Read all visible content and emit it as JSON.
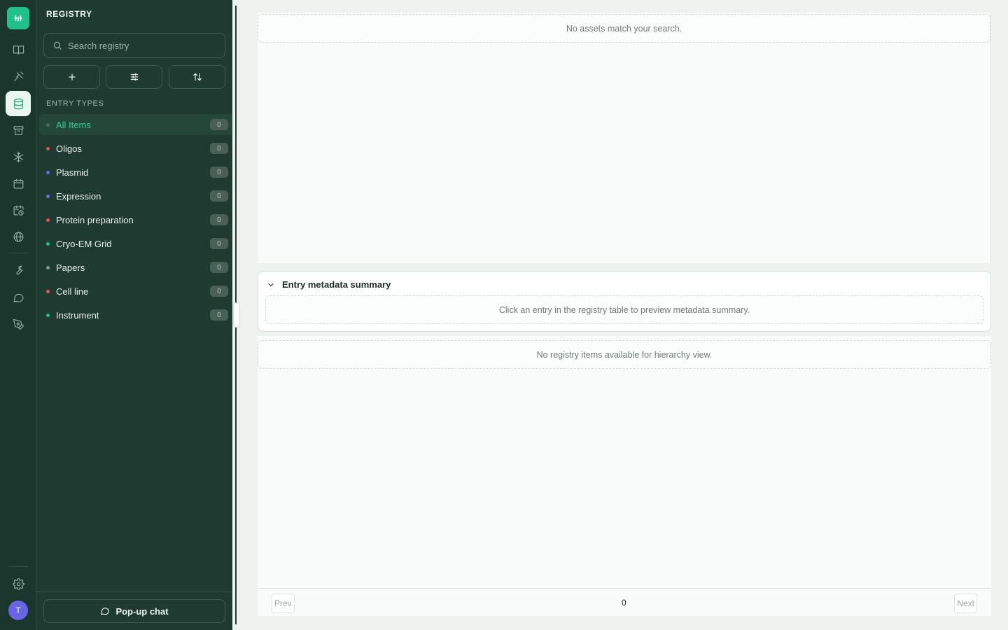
{
  "rail": {
    "logo_icon": "flask-lab-logo-icon",
    "items": [
      {
        "icon": "book-open-icon",
        "active": false
      },
      {
        "icon": "flask-icon",
        "active": false
      },
      {
        "icon": "database-icon",
        "active": true
      },
      {
        "icon": "archive-icon",
        "active": false
      },
      {
        "icon": "snowflake-icon",
        "active": false
      },
      {
        "icon": "calendar-icon",
        "active": false
      },
      {
        "icon": "calendar-clock-icon",
        "active": false
      },
      {
        "icon": "globe-icon",
        "active": false
      },
      {
        "icon": "wrench-icon",
        "active": false
      },
      {
        "icon": "message-circle-icon",
        "active": false
      },
      {
        "icon": "pen-tool-icon",
        "active": false
      }
    ],
    "settings_icon": "gear-icon",
    "avatar_initial": "T"
  },
  "registry": {
    "title": "REGISTRY",
    "search_placeholder": "Search registry",
    "tools": {
      "add_icon": "plus-icon",
      "filter_icon": "sliders-icon",
      "sort_icon": "sort-arrows-icon"
    },
    "section_label": "ENTRY TYPES",
    "types": [
      {
        "label": "All Items",
        "count": "0",
        "color": "#4a6b5c",
        "active": true
      },
      {
        "label": "Oligos",
        "count": "0",
        "color": "#e0574a",
        "active": false
      },
      {
        "label": "Plasmid",
        "count": "0",
        "color": "#6b6ee8",
        "active": false
      },
      {
        "label": "Expression",
        "count": "0",
        "color": "#6b6ee8",
        "active": false
      },
      {
        "label": "Protein preparation",
        "count": "0",
        "color": "#e0574a",
        "active": false
      },
      {
        "label": "Cryo-EM Grid",
        "count": "0",
        "color": "#1fc38a",
        "active": false
      },
      {
        "label": "Papers",
        "count": "0",
        "color": "#8a958f",
        "active": false
      },
      {
        "label": "Cell line",
        "count": "0",
        "color": "#e0574a",
        "active": false
      },
      {
        "label": "Instrument",
        "count": "0",
        "color": "#1fc38a",
        "active": false
      }
    ],
    "popup_chat_label": "Pop-up chat"
  },
  "main": {
    "assets_empty": "No assets match your search.",
    "metadata": {
      "title": "Entry metadata summary",
      "empty": "Click an entry in the registry table to preview metadata summary."
    },
    "hierarchy_empty": "No registry items available for hierarchy view.",
    "pager": {
      "prev": "Prev",
      "count": "0",
      "next": "Next"
    }
  },
  "colors": {
    "accent": "#22c08a",
    "sidebar": "#1f3a30",
    "rail": "#1b362c"
  }
}
